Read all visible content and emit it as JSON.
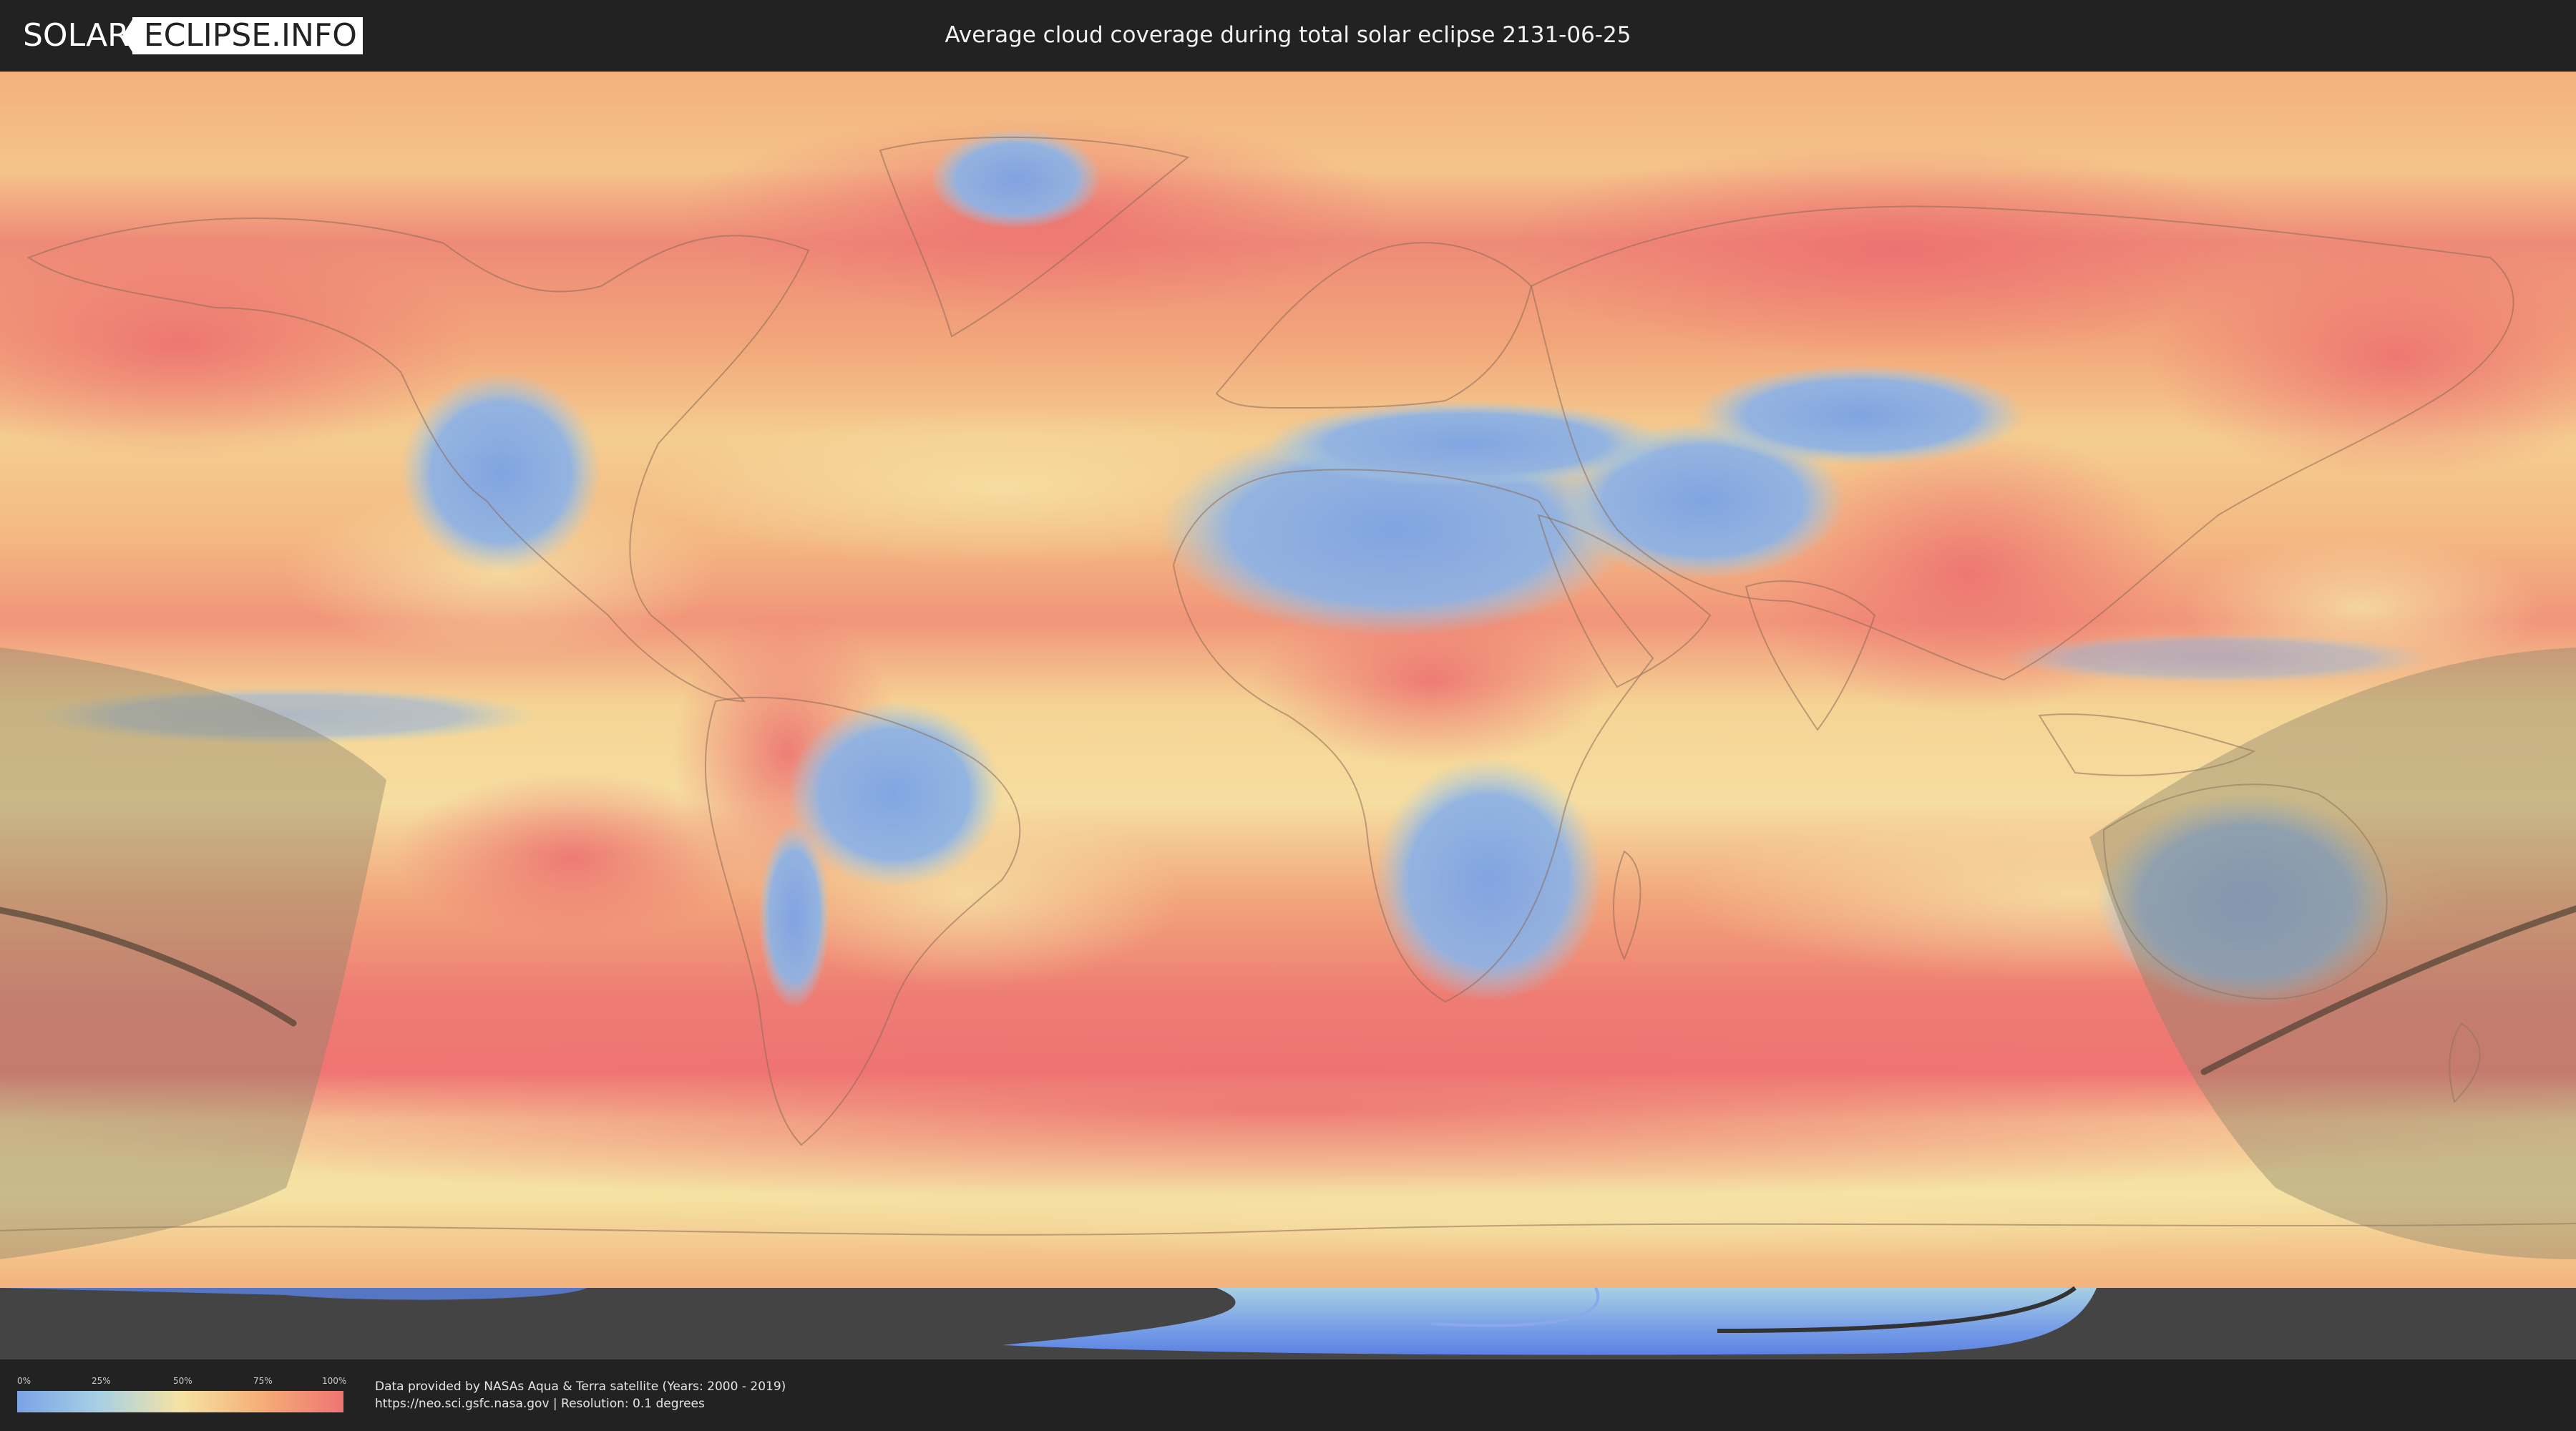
{
  "header": {
    "logo_left": "SOLAR",
    "logo_right": "ECLIPSE.INFO",
    "title": "Average cloud coverage during total solar eclipse 2131-06-25"
  },
  "legend": {
    "ticks": [
      "0%",
      "25%",
      "50%",
      "75%",
      "100%"
    ],
    "colors": [
      "#7ba3e6",
      "#a7d0e4",
      "#f5e3a4",
      "#f5ae77",
      "#ef7473"
    ],
    "min_value": 0,
    "max_value": 100
  },
  "credits": {
    "line1": "Data provided by NASAs Aqua & Terra satellite (Years: 2000 - 2019)",
    "line2": "https://neo.sci.gsfc.nasa.gov | Resolution: 0.1 degrees"
  },
  "map": {
    "palette": {
      "clear": "#7ba3e6",
      "partly": "#a7d0e4",
      "mid": "#f5e3a4",
      "cloudy": "#f5ae77",
      "overcast": "#ef7473",
      "antarctic_ice": "#5b82e4",
      "eclipse_shade": "#808060",
      "path_line": "#3a352a"
    },
    "eclipse_date": "2131-06-25"
  }
}
